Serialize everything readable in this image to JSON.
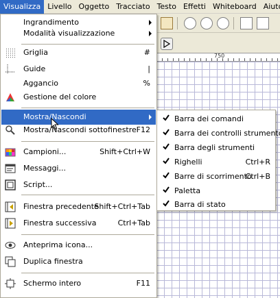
{
  "menubar": {
    "items": [
      "Visualizza",
      "Livello",
      "Oggetto",
      "Tracciato",
      "Testo",
      "Effetti",
      "Whiteboard",
      "Aiuto"
    ],
    "active_index": 0
  },
  "ruler": {
    "label": "750"
  },
  "menu": {
    "items": [
      {
        "label": "Ingrandimento",
        "shortcut": "",
        "submenu": true,
        "icon": "none"
      },
      {
        "label": "Modalità visualizzazione",
        "shortcut": "",
        "submenu": true,
        "icon": "none"
      },
      {
        "label": "Griglia",
        "shortcut": "#",
        "submenu": false,
        "icon": "grid-icon"
      },
      {
        "label": "Guide",
        "shortcut": "|",
        "submenu": false,
        "icon": "guides-icon"
      },
      {
        "label": "Aggancio",
        "shortcut": "%",
        "submenu": false,
        "icon": "none"
      },
      {
        "label": "Gestione del colore",
        "shortcut": "",
        "submenu": false,
        "icon": "color-management-icon"
      },
      {
        "label": "Mostra/Nascondi",
        "shortcut": "",
        "submenu": true,
        "icon": "none"
      },
      {
        "label": "Mostra/Nascondi sottofinestre",
        "shortcut": "F12",
        "submenu": false,
        "icon": "show-hide-dialogs-icon"
      },
      {
        "label": "Campioni...",
        "shortcut": "Shift+Ctrl+W",
        "submenu": false,
        "icon": "swatches-icon"
      },
      {
        "label": "Messaggi...",
        "shortcut": "",
        "submenu": false,
        "icon": "messages-icon"
      },
      {
        "label": "Script...",
        "shortcut": "",
        "submenu": false,
        "icon": "script-icon"
      },
      {
        "label": "Finestra precedente",
        "shortcut": "Shift+Ctrl+Tab",
        "submenu": false,
        "icon": "previous-window-icon"
      },
      {
        "label": "Finestra successiva",
        "shortcut": "Ctrl+Tab",
        "submenu": false,
        "icon": "next-window-icon"
      },
      {
        "label": "Anteprima icona...",
        "shortcut": "",
        "submenu": false,
        "icon": "icon-preview-icon"
      },
      {
        "label": "Duplica finestra",
        "shortcut": "",
        "submenu": false,
        "icon": "duplicate-window-icon"
      },
      {
        "label": "Schermo intero",
        "shortcut": "F11",
        "submenu": false,
        "icon": "fullscreen-icon"
      }
    ]
  },
  "submenu": {
    "items": [
      {
        "label": "Barra dei comandi",
        "shortcut": "",
        "checked": true
      },
      {
        "label": "Barra dei controlli strumento",
        "shortcut": "",
        "checked": true
      },
      {
        "label": "Barra degli strumenti",
        "shortcut": "",
        "checked": true
      },
      {
        "label": "Righelli",
        "shortcut": "Ctrl+R",
        "checked": true
      },
      {
        "label": "Barre di scorrimento",
        "shortcut": "Ctrl+B",
        "checked": true
      },
      {
        "label": "Paletta",
        "shortcut": "",
        "checked": true
      },
      {
        "label": "Barra di stato",
        "shortcut": "",
        "checked": true
      }
    ]
  },
  "colors": {
    "highlight": "#316ac5",
    "menubar_bg": "#ece9d8",
    "grid_line": "#b8b8d8"
  }
}
